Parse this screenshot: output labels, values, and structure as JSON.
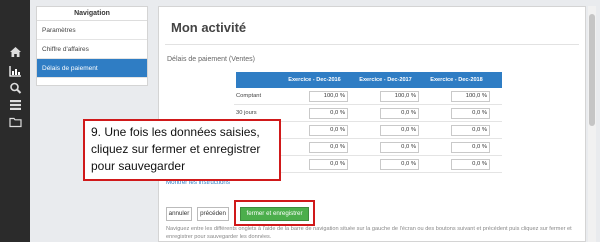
{
  "rail": {
    "icons": [
      "home-icon",
      "bar-chart-icon",
      "search-icon",
      "list-icon",
      "folder-icon"
    ],
    "active": "bar-chart-icon"
  },
  "navigation": {
    "title": "Navigation",
    "items": [
      {
        "label": "Paramètres",
        "active": false
      },
      {
        "label": "Chiffre d'affaires",
        "active": false
      },
      {
        "label": "Délais de paiement",
        "active": true
      }
    ]
  },
  "main": {
    "title": "Mon activité",
    "subtitle": "Délais de paiement (Ventes)",
    "table": {
      "columns": [
        "Exercice - Dec-2016",
        "Exercice - Dec-2017",
        "Exercice - Dec-2018"
      ],
      "rows": [
        {
          "label": "Comptant",
          "values": [
            "100,0 %",
            "100,0 %",
            "100,0 %"
          ]
        },
        {
          "label": "30 jours",
          "values": [
            "0,0 %",
            "0,0 %",
            "0,0 %"
          ]
        },
        {
          "label": "",
          "values": [
            "0,0 %",
            "0,0 %",
            "0,0 %"
          ]
        },
        {
          "label": "",
          "values": [
            "0,0 %",
            "0,0 %",
            "0,0 %"
          ]
        },
        {
          "label": "",
          "values": [
            "0,0 %",
            "0,0 %",
            "0,0 %"
          ]
        }
      ]
    },
    "show_instructions": "Montrer les instructions",
    "buttons": {
      "cancel": "annuler",
      "previous": "précéden",
      "save": "fermer et enregistrer"
    },
    "footnote": "Naviguez entre les différents onglets à l'aide de la barre de navigation située sur la gauche de l'écran ou des boutons suivant et précédent puis cliquez sur fermer et enregistrer pour sauvegarder les données."
  },
  "callout": {
    "text": "9. Une fois les données saisies, cliquez sur fermer et enregistrer pour sauvegarder"
  },
  "colors": {
    "rail": "#2b2b2b",
    "accent": "#2f7dc4",
    "save_button": "#4cae4c",
    "highlight": "#d0191a"
  }
}
